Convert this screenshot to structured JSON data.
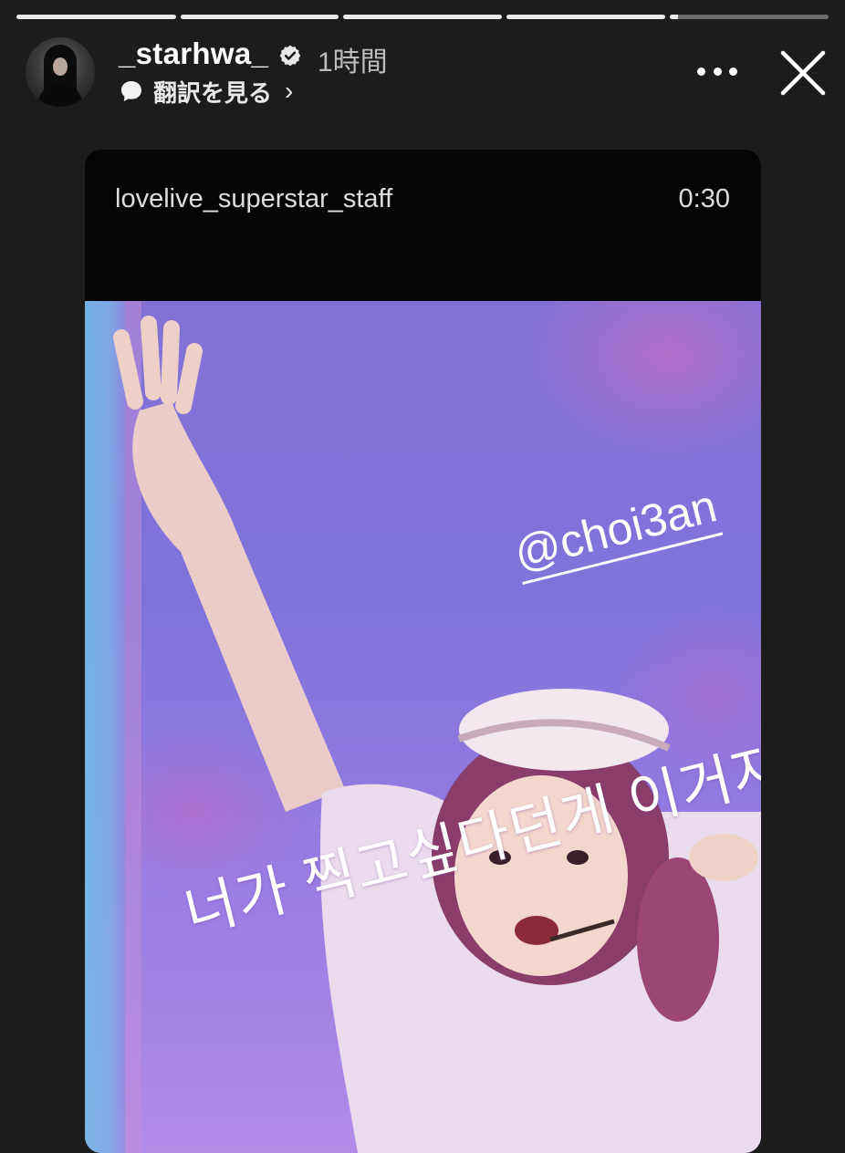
{
  "story": {
    "segments": [
      {
        "state": "done"
      },
      {
        "state": "done"
      },
      {
        "state": "done"
      },
      {
        "state": "done"
      },
      {
        "state": "active",
        "progress": 0.05
      }
    ],
    "user": {
      "username": "_starhwa_",
      "verified": true
    },
    "time_ago": "1時間",
    "translate_label": "翻訳を見る",
    "icons": {
      "more": "more-horizontal-icon",
      "close": "close-icon",
      "translate": "speech-bubble-icon",
      "verified": "verified-badge-icon"
    }
  },
  "embedded_post": {
    "username": "lovelive_superstar_staff",
    "duration": "0:30"
  },
  "overlay": {
    "mention": "@choi3an",
    "caption": "너가 찍고싶다던게 이거지?"
  },
  "colors": {
    "background": "#1c1c1c",
    "scene_purple": "#8471d6",
    "text": "#ffffff"
  }
}
